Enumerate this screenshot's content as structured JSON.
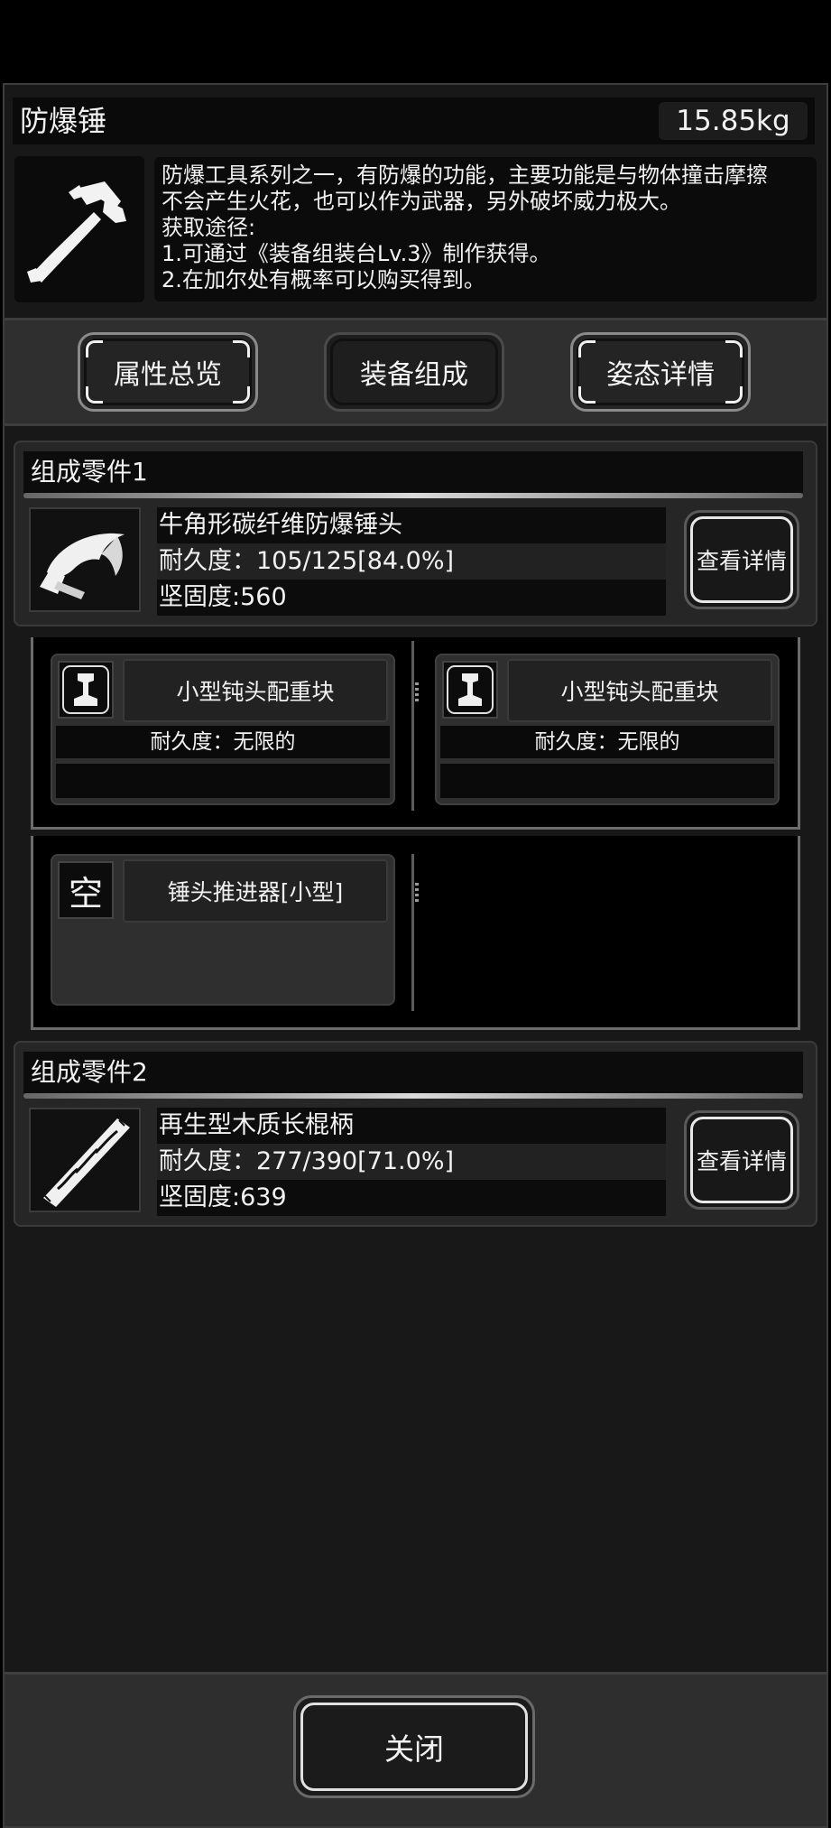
{
  "item": {
    "name": "防爆锤",
    "weight": "15.85kg",
    "icon": "hammer-icon",
    "description": "防爆工具系列之一，有防爆的功能，主要功能是与物体撞击摩擦\n不会产生火花，也可以作为武器，另外破坏威力极大。\n获取途径:\n1.可通过《装备组装台Lv.3》制作获得。\n2.在加尔处有概率可以购买得到。"
  },
  "tabs": [
    {
      "label": "属性总览",
      "active": false
    },
    {
      "label": "装备组成",
      "active": true
    },
    {
      "label": "姿态详情",
      "active": false
    }
  ],
  "parts": [
    {
      "title": "组成零件1",
      "name": "牛角形碳纤维防爆锤头",
      "durability": "耐久度：105/125[84.0%]",
      "hardness": "坚固度:560",
      "detail_label": "查看详情",
      "icon": "horn-hammerhead-icon"
    },
    {
      "title": "组成零件2",
      "name": "再生型木质长棍柄",
      "durability": "耐久度：277/390[71.0%]",
      "hardness": "坚固度:639",
      "detail_label": "查看详情",
      "icon": "wooden-handle-icon"
    }
  ],
  "slots": [
    {
      "name": "小型钝头配重块",
      "durability": "耐久度：无限的",
      "icon": "rail-weight-icon"
    },
    {
      "name": "小型钝头配重块",
      "durability": "耐久度：无限的",
      "icon": "rail-weight-icon"
    },
    {
      "name": "锤头推进器[小型]",
      "icon_text": "空"
    }
  ],
  "close_label": "关闭"
}
